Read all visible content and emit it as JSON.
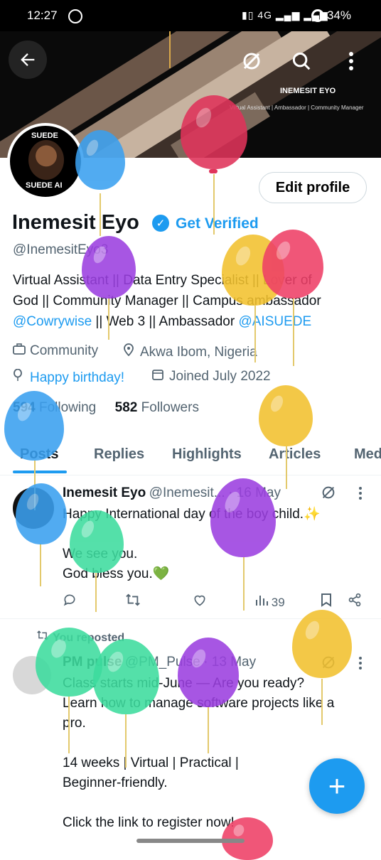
{
  "status_bar": {
    "time": "12:27",
    "network": "4G",
    "battery": "34%"
  },
  "banner": {
    "title": "INEMESIT EYO",
    "subtitle": "Virtual Assistant | Ambassador | Community Manager"
  },
  "avatar_text": {
    "top": "SUEDE",
    "bottom": "SUEDE AI"
  },
  "profile": {
    "edit_profile": "Edit profile",
    "name": "Inemesit Eyo",
    "get_verified": "Get Verified",
    "handle": "@InemesitEyo3",
    "bio_line1": "Virtual Assistant || Data Entry Specialist || Lover of",
    "bio_line2": "God || Community Manager || Campus ambassador",
    "bio_mention1": "@Cowrywise",
    "bio_mid": " || Web 3 || Ambassador ",
    "bio_mention2": "@AISUEDE",
    "category": "Community",
    "location": "Akwa Ibom, Nigeria",
    "birthday": "Happy birthday!",
    "joined": "Joined July 2022",
    "following_count": "594",
    "following_label": "Following",
    "followers_count": "582",
    "followers_label": "Followers"
  },
  "tabs": [
    "Posts",
    "Replies",
    "Highlights",
    "Articles",
    "Media"
  ],
  "tweets": [
    {
      "name": "Inemesit Eyo",
      "handle": "@Inemesit...",
      "date": "· 16 May",
      "line1": "Happy International day of the boy child.✨",
      "line2": "We see you.",
      "line3": "God bless you.💚",
      "views": "39"
    },
    {
      "repost_label": "You reposted",
      "name": "PM pulse",
      "handle": "@PM_Pulse",
      "date": "· 13 May",
      "line1": "Class starts mid-June — Are you ready?",
      "line2": "Learn how to manage software projects like a",
      "line3": "pro.",
      "line4": "14 weeks | Virtual | Practical |",
      "line5": "Beginner-friendly.",
      "line6": "Click the link to register now!"
    }
  ],
  "colors": {
    "accent": "#1d9bf0",
    "text": "#0f1419",
    "muted": "#536471"
  },
  "icons": [
    "back-arrow-icon",
    "grok-icon",
    "search-icon",
    "more-vertical-icon",
    "verified-badge-icon",
    "briefcase-icon",
    "location-pin-icon",
    "balloon-icon",
    "calendar-icon",
    "reply-icon",
    "repost-icon",
    "like-icon",
    "views-icon",
    "bookmark-icon",
    "share-icon",
    "compose-plus-icon"
  ]
}
